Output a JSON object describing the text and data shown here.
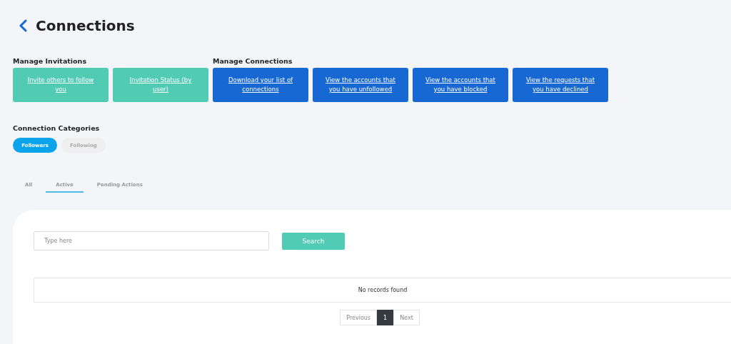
{
  "page": {
    "title": "Connections"
  },
  "action_sections": [
    {
      "heading": "Manage Invitations",
      "kind": "teal",
      "buttons": [
        "Invite others to follow you",
        "Invitation Status (by user)"
      ]
    },
    {
      "heading": "Manage Connections",
      "kind": "blue",
      "buttons": [
        "Download your list of connections",
        "View the accounts that you have unfollowed",
        "View the accounts that you have blocked",
        "View the requests that you have declined"
      ]
    }
  ],
  "categories": {
    "heading": "Connection Categories",
    "pills": [
      {
        "label": "Followers",
        "selected": true
      },
      {
        "label": "Following",
        "selected": false
      }
    ]
  },
  "tabs": [
    {
      "label": "All",
      "selected": false
    },
    {
      "label": "Active",
      "selected": true
    },
    {
      "label": "Pending Actions",
      "selected": false
    }
  ],
  "search": {
    "placeholder": "Type here",
    "button": "Search"
  },
  "table": {
    "empty_message": "No records found"
  },
  "pagination": {
    "previous": "Previous",
    "pages": [
      {
        "label": "1",
        "selected": true
      }
    ],
    "next": "Next"
  }
}
